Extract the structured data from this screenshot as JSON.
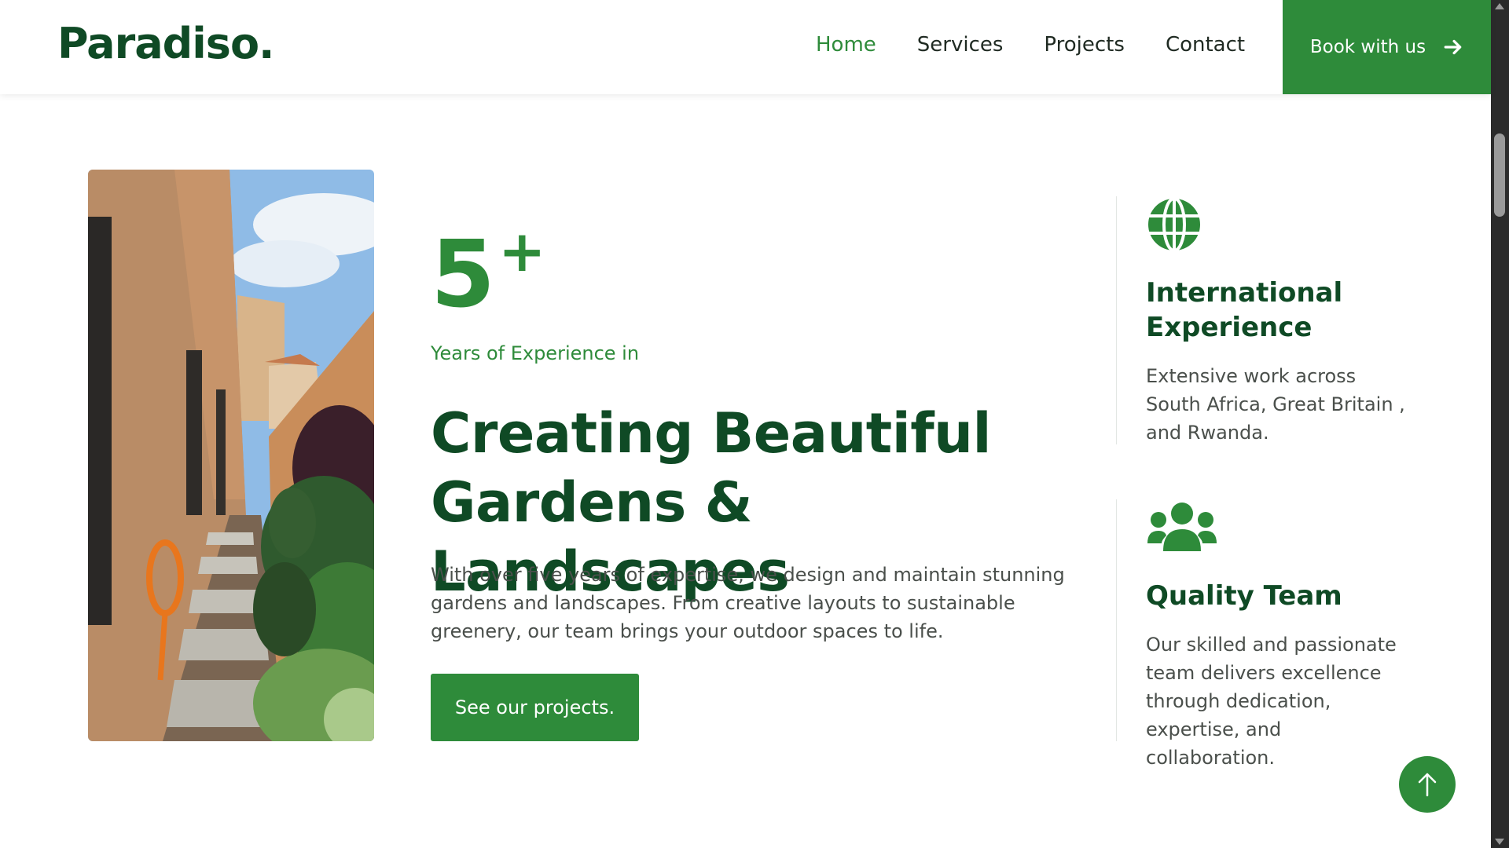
{
  "header": {
    "logo": "Paradiso.",
    "nav": [
      {
        "label": "Home",
        "active": true
      },
      {
        "label": "Services",
        "active": false
      },
      {
        "label": "Projects",
        "active": false
      },
      {
        "label": "Contact",
        "active": false
      }
    ],
    "book_label": "Book with us",
    "book_icon": "arrow-right-icon"
  },
  "hero": {
    "image_icon": "garden-path-photo",
    "years_number": "5",
    "years_suffix": "+",
    "subtitle": "Years of Experience in",
    "headline_line1": "Creating Beautiful",
    "headline_line2": "Gardens & Landscapes",
    "description": "With over five years of expertise, we design and maintain stunning gardens and landscapes. From creative layouts to sustainable greenery, our team brings your outdoor spaces to life.",
    "cta_label": "See our projects."
  },
  "features": [
    {
      "icon": "globe-icon",
      "title_line1": "International",
      "title_line2": "Experience",
      "text": "Extensive work across South Africa, Great Britain , and Rwanda."
    },
    {
      "icon": "team-icon",
      "title_line1": "Quality Team",
      "title_line2": "",
      "text": "Our skilled and passionate team delivers excellence through dedication, expertise, and collaboration."
    }
  ],
  "back_to_top_icon": "arrow-up-icon",
  "colors": {
    "brand_green": "#2e8b3a",
    "dark_green": "#0f4a25",
    "body_text": "#4a4f4b"
  }
}
